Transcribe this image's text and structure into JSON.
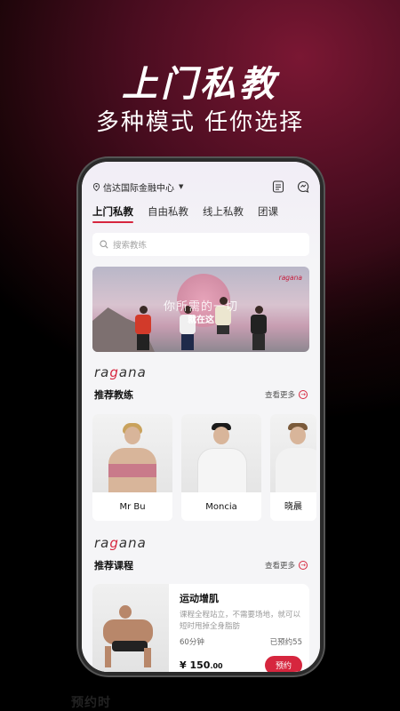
{
  "hero": {
    "title": "上门私教",
    "subtitle": "多种模式  任你选择"
  },
  "topbar": {
    "location": "信达国际金融中心"
  },
  "tabs": [
    {
      "label": "上门私教",
      "active": true
    },
    {
      "label": "自由私教",
      "active": false
    },
    {
      "label": "线上私教",
      "active": false
    },
    {
      "label": "团课",
      "active": false
    }
  ],
  "search": {
    "placeholder": "搜索教练"
  },
  "banner": {
    "brand": "ragana",
    "title": "你所需的一切",
    "subtitle": "就在这"
  },
  "brand_pre": "ra",
  "brand_g": "g",
  "brand_post": "ana",
  "coaches_section": {
    "title": "推荐教练",
    "more": "查看更多"
  },
  "coaches": [
    {
      "name": "Mr Bu"
    },
    {
      "name": "Moncia"
    },
    {
      "name": "晓晨"
    }
  ],
  "courses_section": {
    "title": "推荐课程",
    "more": "查看更多"
  },
  "course": {
    "title": "运动增肌",
    "desc": "课程全程站立，不需要场地，就可以短时甩掉全身脂肪",
    "duration": "60分钟",
    "booked": "已预约55",
    "price": "¥ 150",
    "price_dec": ".00",
    "book_label": "预约"
  },
  "footer_text": "预约时",
  "colors": {
    "accent": "#d6263e",
    "bg_dark": "#4a0d20"
  }
}
